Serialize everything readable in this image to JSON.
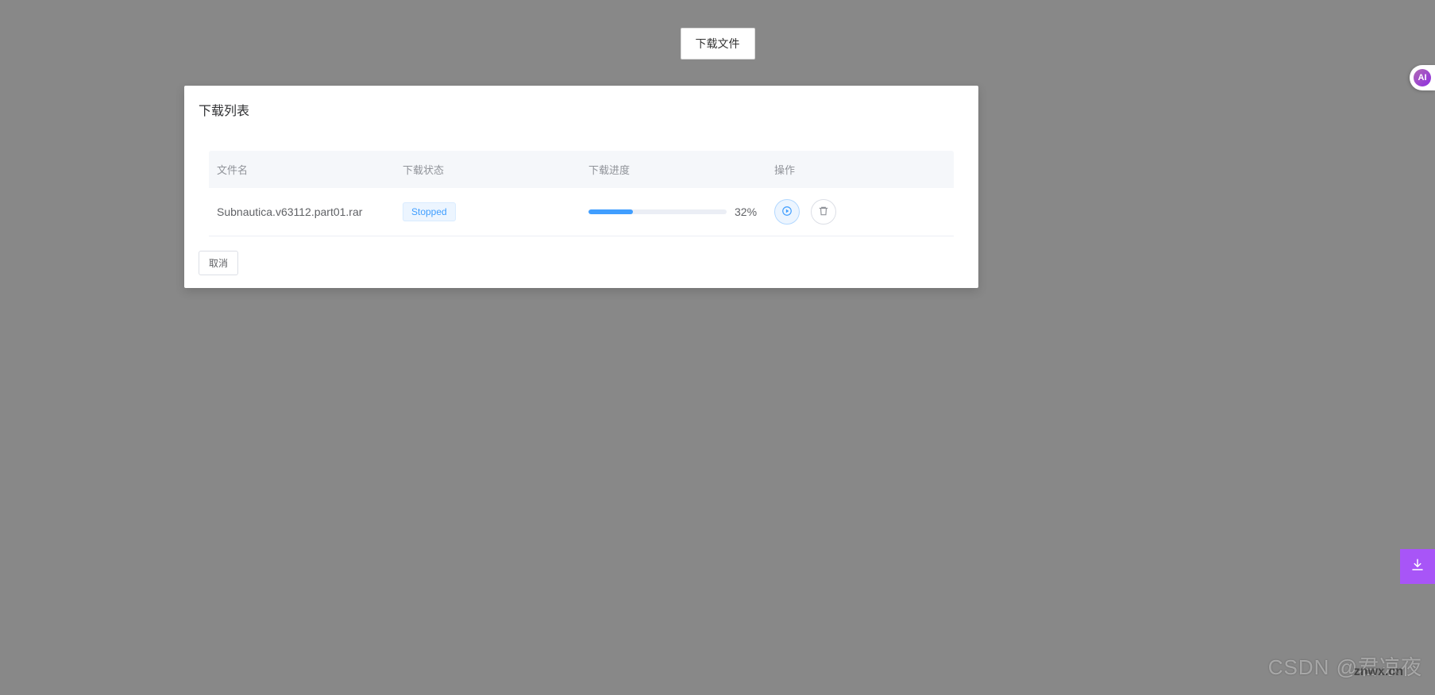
{
  "header": {
    "download_button": "下载文件"
  },
  "modal": {
    "title": "下载列表",
    "cancel": "取消"
  },
  "table": {
    "headers": {
      "name": "文件名",
      "status": "下载状态",
      "progress": "下载进度",
      "action": "操作"
    },
    "rows": [
      {
        "name": "Subnautica.v63112.part01.rar",
        "status": "Stopped",
        "progress_percent": 32,
        "progress_text": "32%"
      }
    ]
  },
  "float_badge": "AI",
  "watermark": "CSDN @君凉夜",
  "watermark2": "znwx.cn"
}
